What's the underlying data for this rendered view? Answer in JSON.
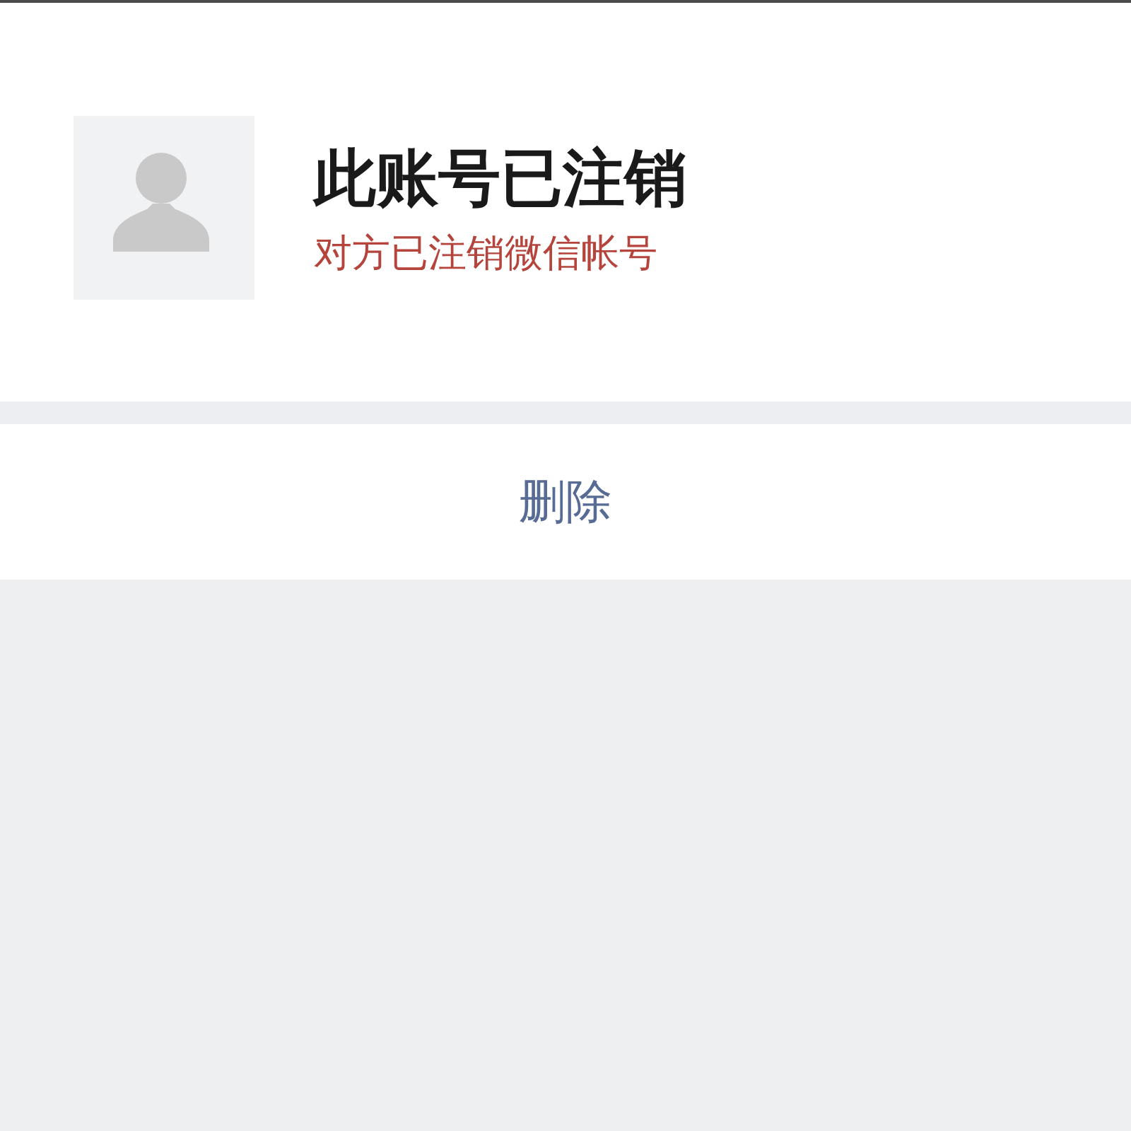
{
  "profile": {
    "name": "此账号已注销",
    "status": "对方已注销微信帐号"
  },
  "actions": [
    {
      "label": "删除"
    }
  ]
}
